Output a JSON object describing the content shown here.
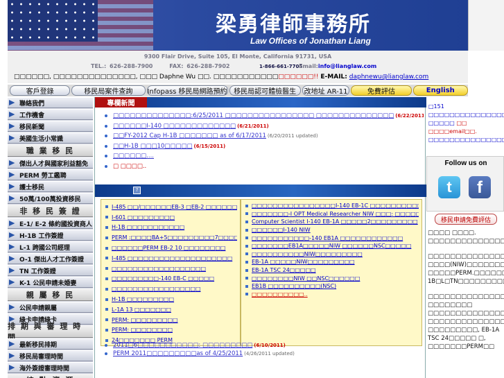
{
  "header": {
    "firm_cn": "梁勇律師事務所",
    "firm_en": "Law Offices of Jonathan Liang"
  },
  "address": {
    "line1": "9300 Flair Drive, Suite 105, El Monte, California 91731, USA",
    "tel": "TEL.: 626-288-7900",
    "fax": "FAX: 626-288-7902",
    "tollfree": "1-866-661-7705",
    "email_label": "Email:",
    "email": "info@lianglaw.com",
    "contact_text": "□□□□□□, □□□□□□□□□□□□□□, □□□ Daphne Wu □□. □□□□□□□□□□□",
    "contact_red": "□□□□□□!!",
    "contact_email_label": "E-MAIL:",
    "contact_email": "daphnewu@lianglaw.com"
  },
  "nav": [
    {
      "label": "客戶登錄",
      "style": "normal"
    },
    {
      "label": "移民局案件查詢",
      "style": "normal"
    },
    {
      "label": "Infopass 移民局網路預約",
      "style": "normal"
    },
    {
      "label": "移民局認可體檢醫生",
      "style": "normal"
    },
    {
      "label": "改地址 AR-11",
      "style": "normal"
    },
    {
      "label": "免費評估",
      "style": "yellow"
    },
    {
      "label": "English",
      "style": "eng"
    }
  ],
  "sidebar": {
    "items": [
      {
        "label": "聯絡我們",
        "kind": "item"
      },
      {
        "label": "工作機會",
        "kind": "item"
      },
      {
        "label": "移民新聞",
        "kind": "item"
      },
      {
        "label": "美國生活小常識",
        "kind": "item"
      },
      {
        "label": "職 業 移 民",
        "kind": "head"
      },
      {
        "label": "傑出人才與國家利益豁免",
        "kind": "item"
      },
      {
        "label": "PERM 勞工鑑聘",
        "kind": "item"
      },
      {
        "label": "護士移民",
        "kind": "item"
      },
      {
        "label": "50萬/100萬投資移民",
        "kind": "item"
      },
      {
        "label": "非 移 民 簽 證",
        "kind": "head"
      },
      {
        "label": "E-1/ E-2 條約國投資商人",
        "kind": "item"
      },
      {
        "label": "H-1B 工作簽證",
        "kind": "item"
      },
      {
        "label": "L-1 跨國公司經理",
        "kind": "item"
      },
      {
        "label": "O-1 傑出人才工作簽證",
        "kind": "item"
      },
      {
        "label": "TN 工作簽證",
        "kind": "item"
      },
      {
        "label": "K-1 公民申請未婚妻",
        "kind": "item"
      },
      {
        "label": "親 屬 移 民",
        "kind": "head"
      },
      {
        "label": "公民申請親屬",
        "kind": "item"
      },
      {
        "label": "綠卡申請綠卡",
        "kind": "item"
      },
      {
        "label": "排 期 與 審 理 時 間",
        "kind": "head"
      },
      {
        "label": "最新移民排期",
        "kind": "item"
      },
      {
        "label": "移民局審理時間",
        "kind": "item"
      },
      {
        "label": "海外簽證審理時間",
        "kind": "item"
      },
      {
        "label": "綜 點 資 源",
        "kind": "head"
      }
    ]
  },
  "main": {
    "news_tab": "專欄新聞",
    "news": [
      {
        "text": "□□□□□□□□□□□□□□:6/25/2011 □□□□□□□□□□□□□□□□ □□□□□□□□□□□□□□",
        "date": "(6/22/2011)",
        "date_style": "red",
        "style": "link"
      },
      {
        "text": "□□□□□□I-140 □□□□□□□□□□□□□",
        "date": "(6/21/2011)",
        "date_style": "red",
        "style": "link"
      },
      {
        "text": "□□FY-2012 Cap H-1B □□□□□□□ as of 6/17/2011",
        "date": "(6/20/2011 updated)",
        "date_style": "gray",
        "style": "link"
      },
      {
        "text": "□□H-1B □□□10□□□□□",
        "date": "(6/15/2011)",
        "date_style": "red",
        "style": "link"
      },
      {
        "text": "□□□□□□....",
        "date": "",
        "date_style": "red",
        "style": "link"
      },
      {
        "text": "□    □□□□..",
        "date": "",
        "date_style": "red",
        "style": "red"
      }
    ],
    "left_col": [
      "I-485 □□/□□□□□□EB-3 □EB-2 □□□□□□",
      "I-601 □□□□□□□□□",
      "H-1B □□□□□□□□□□□",
      "PERM :□□□□BA+5□□□□□□□□□7□□□□□□□",
      "□□□□□□PERM EB-2 10 □□□□□□□□",
      "I-485 □□□□□□□□□□□□□□□□□□□□",
      "□□□□□□□□□□□□□□□□□□",
      "□□□□□□□□□-140 EB-C □□□□□",
      "□□□□□□□□□□□□□□□□□",
      "H-1B □□□□□□□□□",
      "L-1A 13 □□□□□□□",
      "PERM: □□□□□□□□□",
      "PERM: □□□□□□□□",
      "24□□□□□□□ PERM"
    ],
    "right_col": [
      "□□□□□□□□□□□□□□□□I-140 EB-1C □□□□□□□□□□□□□□□□",
      "□□□□□□□-I OPT Medical Researcher NIW □□□: □□□□□□□□□□□",
      "Computer Scientist I-140 EB-1A □□□□□2□□□□□□□□□",
      "□□□□□□I-140 NIW",
      "□□□□□□□□□□□-140 EB1A □□□□□□□□□□□□",
      "□□□□□□□EB1A□□□□□NIW □□□□□□NSC□□□□□",
      "□□□□□□□□□□NIW□□□□□□□□□",
      "EB-1A □□□□□NIW□□□□□□□□□",
      "EB-1A TSC 24□□□□□",
      "□□□□□□□□NIW □□NSC□□□□□□",
      "EB1B □□□□□□□□□□(NSC)",
      "□□□□□□□□□□.."
    ],
    "bottom_news": [
      {
        "text": "2011□6□□□□□□□□□□□: □□□□□□□□□",
        "date": "(6/10/2011)",
        "date_style": "red"
      },
      {
        "text": "PERM 2011□□□□□□□□□as of 4/25/2011",
        "date": "(4/26/2011 updated)",
        "date_style": "gray"
      }
    ]
  },
  "right": {
    "top_blue": "□151 □□□□□□□□□□□□□□□□2011□6□10□□□□. □□□□□",
    "top_red": "□□ □□□□email□□.",
    "top_tail": "□□□□□□□□□□□□□□□□□□□□□□□□□□□□□□□□□",
    "follow": "Follow us on",
    "twitter": "t",
    "facebook": "f",
    "consult": "移民申請免費評估",
    "body": [
      "□□□□ □□□□. □□□□□□□□□□□□□□□□□□□□□□□□□□□□□□□□□□□□□□□□□□□□□□□□□□□□□□□□□□□□□",
      "□□□□□□□□□□□□□□□□□□□□□□□EB1. □□□□(NIW)□□□□□□□ □□□□□PERM.□□□□□□□□□H-1B□L□TN□□□□□□□□□□□□□□□□□□□□□□□□□□□□□",
      "□□□□□□□□□□□□□□□□□□□□50□□. □□□□□□□□ □□□□□□□□□□□□□□□□□□. □□□□□□□□□□□□□□□□□□□□□□□□□□□□□□□□□□□□□□□□□□□NIW □□□□□□□□□, EB-1A TSC 24□□□□□ □, □□□□□□□PERM□□"
    ]
  }
}
